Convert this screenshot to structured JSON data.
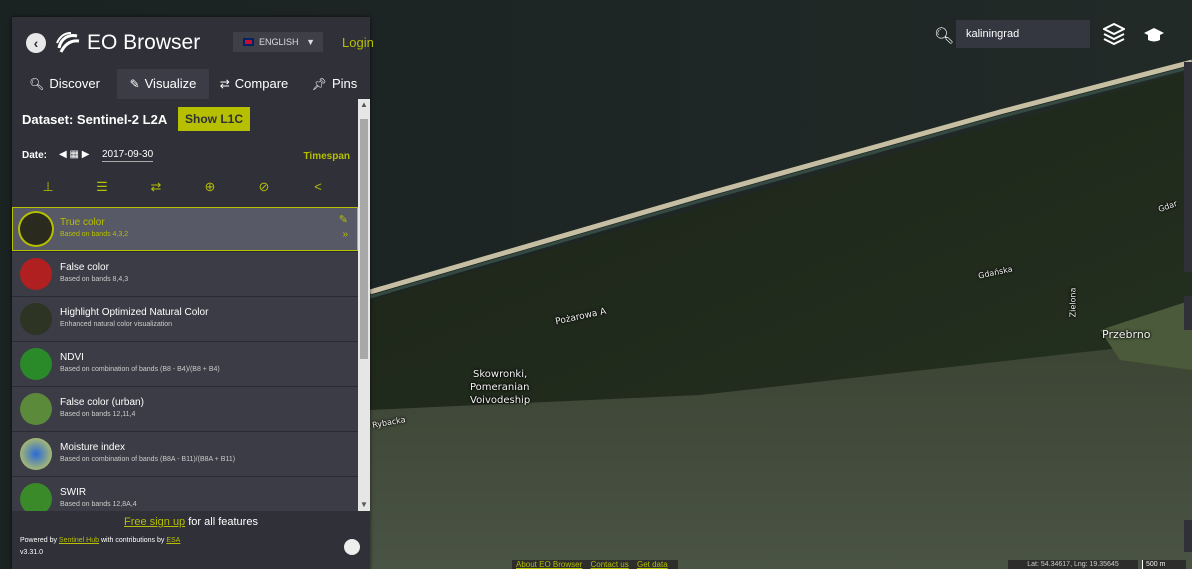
{
  "app": {
    "title": "EO Browser",
    "language": "ENGLISH",
    "login": "Login"
  },
  "tabs": [
    {
      "label": "Discover",
      "icon": "search-icon"
    },
    {
      "label": "Visualize",
      "icon": "brush-icon"
    },
    {
      "label": "Compare",
      "icon": "swap-icon"
    },
    {
      "label": "Pins",
      "icon": "pin-icon"
    }
  ],
  "dataset": {
    "label": "Dataset: Sentinel-2 L2A",
    "button": "Show L1C"
  },
  "date": {
    "label": "Date:",
    "value": "2017-09-30",
    "timespan": "Timespan"
  },
  "layers": [
    {
      "title": "True color",
      "subtitle": "Based on bands 4,3,2",
      "selected": true
    },
    {
      "title": "False color",
      "subtitle": "Based on bands 8,4,3"
    },
    {
      "title": "Highlight Optimized Natural Color",
      "subtitle": "Enhanced natural color visualization"
    },
    {
      "title": "NDVI",
      "subtitle": "Based on combination of bands (B8 - B4)/(B8 + B4)"
    },
    {
      "title": "False color (urban)",
      "subtitle": "Based on bands 12,11,4"
    },
    {
      "title": "Moisture index",
      "subtitle": "Based on combination of bands (B8A - B11)/(B8A + B11)"
    },
    {
      "title": "SWIR",
      "subtitle": "Based on bands 12,8A,4"
    }
  ],
  "footer": {
    "signup_link": "Free sign up",
    "signup_rest": "for all features",
    "powered_prefix": "Powered by",
    "powered_link": "Sentinel Hub",
    "powered_mid": "with contributions by",
    "powered_esa": "ESA",
    "version": "v3.31.0"
  },
  "search": {
    "value": "kaliningrad"
  },
  "map_labels": {
    "pozarowa": "Pożarowa A",
    "skowronki_1": "Skowronki,",
    "skowronki_2": "Pomeranian",
    "skowronki_3": "Voivodeship",
    "rybacka": "Rybacka",
    "gdanska": "Gdańska",
    "gdan": "Gdar",
    "zielona": "Zielona",
    "przebrno": "Przebrno"
  },
  "bottom": {
    "about": "About EO Browser",
    "contact": "Contact us",
    "getdata": "Get data",
    "coords": "Lat: 54.34617, Lng: 19.35645",
    "scale": "500 m"
  },
  "colors": {
    "accent": "#b6bf00",
    "panel": "#2f3038"
  }
}
